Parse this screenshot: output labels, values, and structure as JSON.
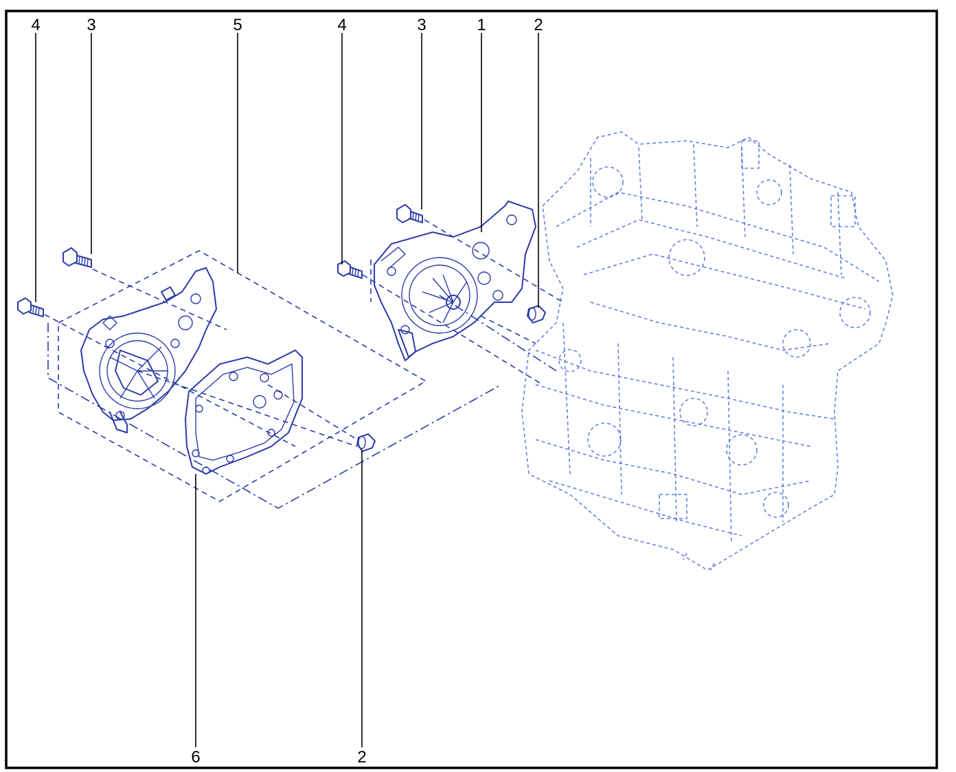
{
  "diagram": {
    "colors": {
      "frame": "#000000",
      "part_line": "#2a3aa8",
      "ghost_line": "#4a6ad8",
      "background": "#ffffff"
    },
    "callouts_top": [
      {
        "label": "4",
        "ref": "bolt-left"
      },
      {
        "label": "3",
        "ref": "bolt-left-upper"
      },
      {
        "label": "5",
        "ref": "pump-assembly-exploded"
      },
      {
        "label": "4",
        "ref": "bolt-right"
      },
      {
        "label": "3",
        "ref": "bolt-right-upper"
      },
      {
        "label": "1",
        "ref": "water-pump"
      },
      {
        "label": "2",
        "ref": "dowel-right"
      }
    ],
    "callouts_bottom": [
      {
        "label": "6",
        "ref": "gasket"
      },
      {
        "label": "2",
        "ref": "dowel-left"
      }
    ]
  }
}
